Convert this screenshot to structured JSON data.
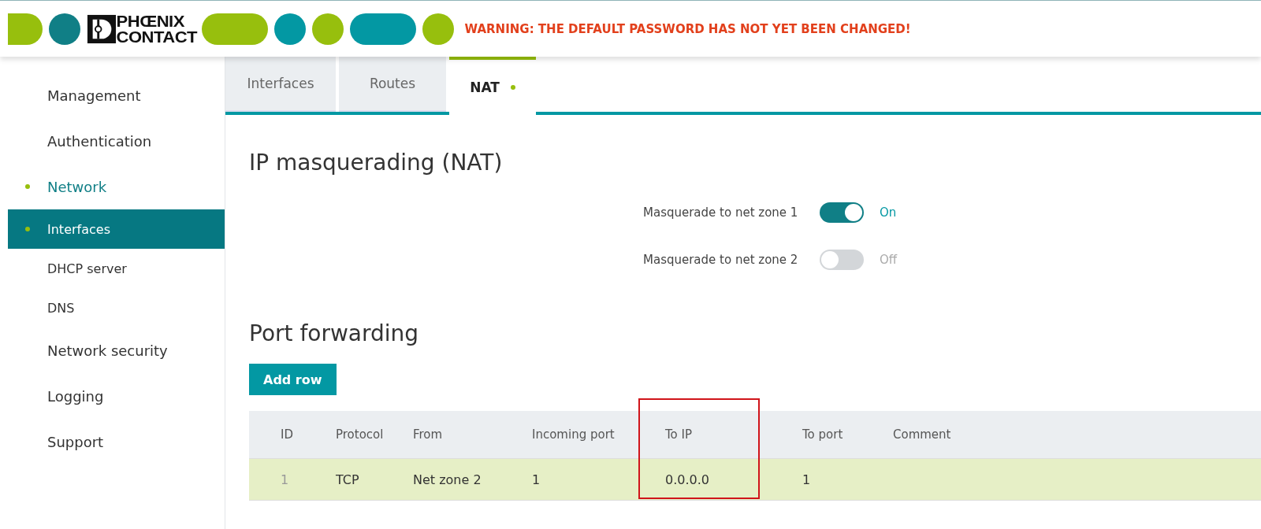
{
  "header": {
    "logo": [
      "PHŒNIX",
      "CONTACT"
    ],
    "warning": "WARNING: THE DEFAULT PASSWORD HAS NOT YET BEEN CHANGED!"
  },
  "sidebar": {
    "items": [
      {
        "label": "Management",
        "selected": false
      },
      {
        "label": "Authentication",
        "selected": false
      },
      {
        "label": "Network",
        "selected": true,
        "children": [
          {
            "label": "Interfaces",
            "selected": true
          },
          {
            "label": "DHCP server",
            "selected": false
          },
          {
            "label": "DNS",
            "selected": false
          }
        ]
      },
      {
        "label": "Network security",
        "selected": false
      },
      {
        "label": "Logging",
        "selected": false
      },
      {
        "label": "Support",
        "selected": false
      }
    ]
  },
  "tabs": [
    {
      "label": "Interfaces",
      "selected": false
    },
    {
      "label": "Routes",
      "selected": false
    },
    {
      "label": "NAT",
      "selected": true
    }
  ],
  "nat": {
    "title": "IP masquerading (NAT)",
    "toggles": [
      {
        "label": "Masquerade to net zone 1",
        "on": true,
        "state_text": "On"
      },
      {
        "label": "Masquerade to net zone 2",
        "on": false,
        "state_text": "Off"
      }
    ]
  },
  "port_forwarding": {
    "title": "Port forwarding",
    "add_button": "Add row",
    "table": {
      "columns": [
        {
          "label": "ID",
          "highlighted": false
        },
        {
          "label": "Protocol",
          "highlighted": false
        },
        {
          "label": "From",
          "highlighted": false
        },
        {
          "label": "Incoming port",
          "highlighted": false
        },
        {
          "label": "To IP",
          "highlighted": true
        },
        {
          "label": "To port",
          "highlighted": false
        },
        {
          "label": "Comment",
          "highlighted": false
        }
      ],
      "rows": [
        [
          "1",
          "TCP",
          "Net zone 2",
          "1",
          "0.0.0.0",
          "1"
        ]
      ]
    }
  }
}
